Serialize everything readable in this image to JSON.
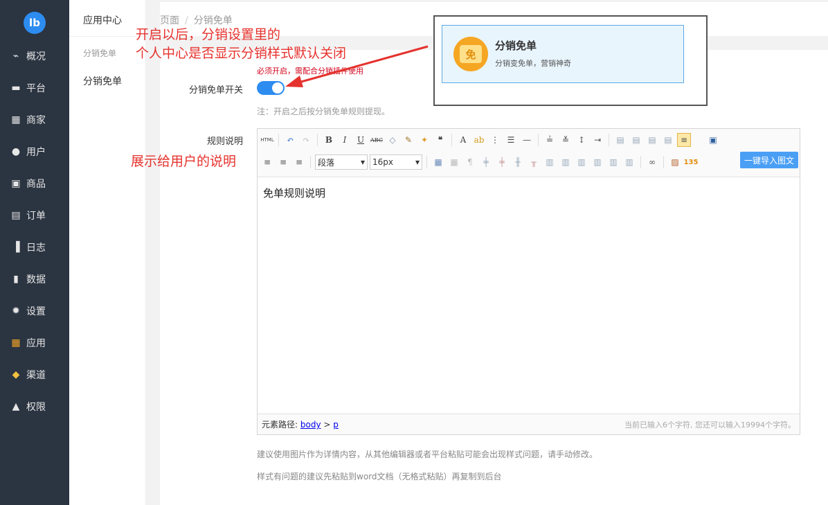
{
  "sidebar": {
    "logo_text": "lb",
    "items": [
      {
        "label": "概况",
        "icon": "chart-icon"
      },
      {
        "label": "平台",
        "icon": "monitor-icon"
      },
      {
        "label": "商家",
        "icon": "store-icon"
      },
      {
        "label": "用户",
        "icon": "user-icon"
      },
      {
        "label": "商品",
        "icon": "goods-icon"
      },
      {
        "label": "订单",
        "icon": "order-icon"
      },
      {
        "label": "日志",
        "icon": "book-icon"
      },
      {
        "label": "数据",
        "icon": "bar-chart-icon"
      },
      {
        "label": "设置",
        "icon": "gear-icon"
      },
      {
        "label": "应用",
        "icon": "apps-icon"
      },
      {
        "label": "渠道",
        "icon": "cube-icon"
      },
      {
        "label": "权限",
        "icon": "lock-icon"
      }
    ]
  },
  "subsidebar": {
    "title": "应用中心",
    "group": "分销免单",
    "item": "分销免单"
  },
  "breadcrumb": {
    "root": "页面",
    "separator": "/",
    "current": "分销免单"
  },
  "form": {
    "required_hint": "必须开启，需配合分销插件使用",
    "switch_label": "分销免单开关",
    "switch_on": true,
    "switch_note": "注：开启之后按分销免单规则提现。",
    "rules_label": "规则说明"
  },
  "editor": {
    "paragraph_select": "段落",
    "fontsize_select": "16px",
    "import_button": "一键导入图文",
    "content": "免单规则说明",
    "path_label": "元素路径:",
    "path_body": "body",
    "path_sep": ">",
    "path_p": "p",
    "count_text": "当前已输入6个字符, 您还可以输入19994个字符。"
  },
  "help": {
    "line1": "建议使用图片作为详情内容，从其他编辑器或者平台粘贴可能会出现样式问题，请手动修改。",
    "line2": "样式有问题的建议先粘贴到word文档（无格式粘贴）再复制到后台"
  },
  "annotations": {
    "top_line1": "开启以后，分销设置里的",
    "top_line2": "个人中心是否显示分销样式默认关闭",
    "side": "展示给用户的说明"
  },
  "callout_card": {
    "icon_char": "免",
    "title": "分销免单",
    "subtitle": "分销变免单，营销神奇"
  },
  "colors": {
    "sidebar": "#2b3441",
    "accent": "#2d8cf0",
    "annotation": "#e5322d"
  }
}
